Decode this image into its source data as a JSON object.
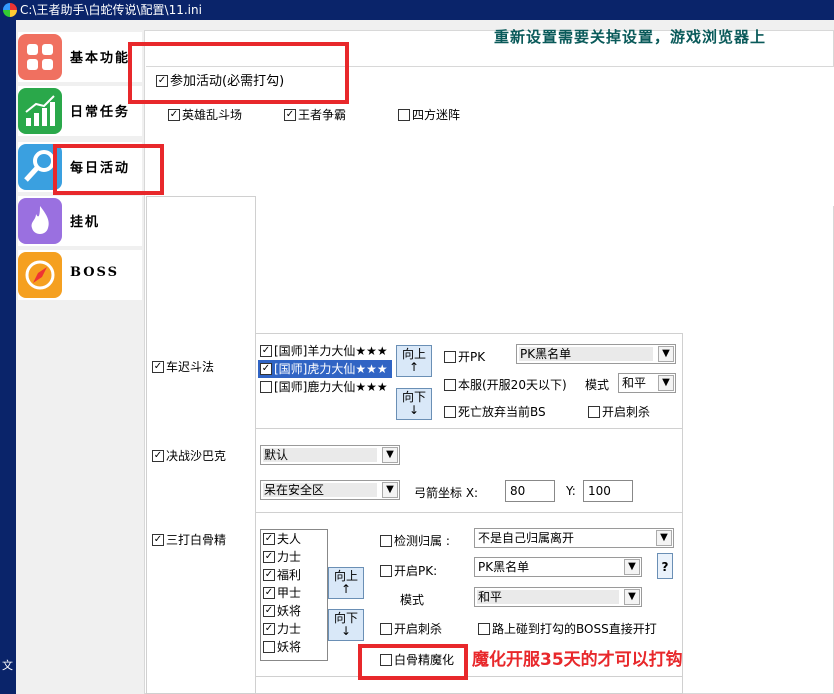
{
  "window": {
    "title": "C:\\王者助手\\白蛇传说\\配置\\11.ini"
  },
  "leftstrip": {
    "text": "文"
  },
  "sidebar": {
    "items": [
      {
        "label": "基本功能",
        "color": "#f07060"
      },
      {
        "label": "日常任务",
        "color": "#2aa84a"
      },
      {
        "label": "每日活动",
        "color": "#3aa0e0"
      },
      {
        "label": "挂机",
        "color": "#9a70e0"
      },
      {
        "label": "BOSS",
        "color": "#f5a020"
      }
    ]
  },
  "banner": "重新设置需要关掉设置，游戏浏览器上",
  "join": {
    "label": "参加活动(必需打勾)",
    "checked": true
  },
  "activities": [
    {
      "label": "英雄乱斗场",
      "checked": true
    },
    {
      "label": "王者争霸",
      "checked": true
    },
    {
      "label": "四方迷阵",
      "checked": false
    }
  ],
  "chechi": {
    "label": "车迟斗法",
    "checked": true,
    "list": [
      {
        "text": "[国师]羊力大仙★★★",
        "checked": true,
        "selected": false
      },
      {
        "text": "[国师]虎力大仙★★★",
        "checked": true,
        "selected": true
      },
      {
        "text": "[国师]鹿力大仙★★★",
        "checked": false,
        "selected": false
      }
    ],
    "up": "向上",
    "down": "向下",
    "arrow_up": "↑",
    "arrow_down": "↓",
    "pk_label": "开PK",
    "pk_checked": false,
    "pk_list_value": "PK黑名单",
    "server_label": "本服(开服20天以下)",
    "server_checked": false,
    "mode_label": "模式",
    "mode_value": "和平",
    "death_label": "死亡放弃当前BS",
    "death_checked": false,
    "assassin_label": "开启刺杀",
    "assassin_checked": false
  },
  "shabake": {
    "label": "决战沙巴克",
    "checked": true,
    "combo1": "默认",
    "combo2": "呆在安全区",
    "bow_label": "弓箭坐标 X:",
    "x": "80",
    "y_label": "Y:",
    "y": "100"
  },
  "baigu": {
    "label": "三打白骨精",
    "checked": true,
    "list": [
      {
        "text": "夫人",
        "checked": true
      },
      {
        "text": "力士",
        "checked": true
      },
      {
        "text": "福利",
        "checked": true
      },
      {
        "text": "甲士",
        "checked": true
      },
      {
        "text": "妖将",
        "checked": true
      },
      {
        "text": "力士",
        "checked": true
      },
      {
        "text": "妖将",
        "checked": false
      }
    ],
    "up": "向上",
    "down": "向下",
    "arrow_up": "↑",
    "arrow_down": "↓",
    "detect_label": "检测归属 :",
    "detect_checked": false,
    "detect_value": "不是自己归属离开",
    "pk_label": "开启PK:",
    "pk_checked": false,
    "pk_value": "PK黑名单",
    "help": "?",
    "mode_label": "模式",
    "mode_value": "和平",
    "assassin_label": "开启刺杀",
    "assassin_checked": false,
    "boss_label": "路上碰到打勾的BOSS直接开打",
    "boss_checked": false,
    "demon_label": "白骨精魔化",
    "demon_checked": false
  },
  "note": "魔化开服35天的才可以打钩",
  "accent": "#e8282b"
}
